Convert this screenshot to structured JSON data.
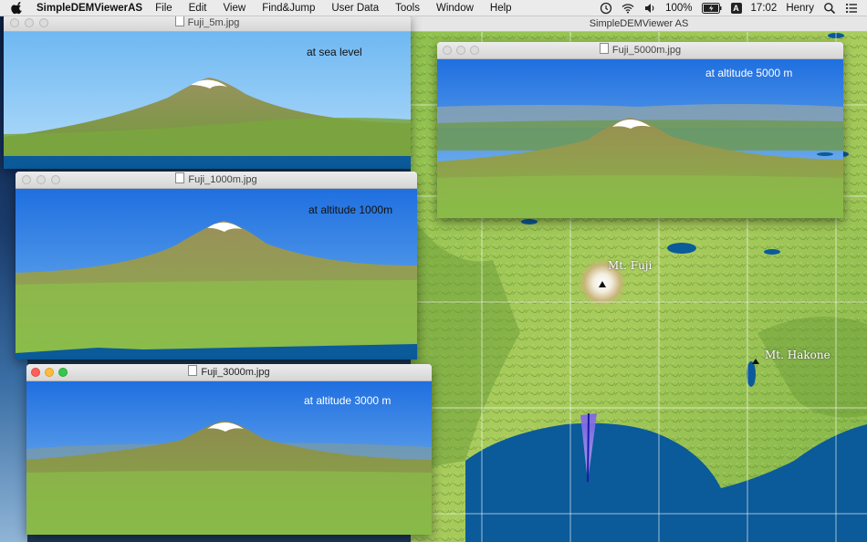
{
  "menubar": {
    "app_name": "SimpleDEMViewerAS",
    "items": [
      "File",
      "Edit",
      "View",
      "Find&Jump",
      "User Data",
      "Tools",
      "Window",
      "Help"
    ],
    "battery": "100%",
    "input_source": "A",
    "clock": "17:02",
    "user": "Henry"
  },
  "main_window": {
    "title": "SimpleDEMViewer AS",
    "labels": {
      "fuji": "Mt. Fuji",
      "hakone": "Mt. Hakone"
    }
  },
  "windows": [
    {
      "title": "Fuji_5m.jpg",
      "caption": "at sea level"
    },
    {
      "title": "Fuji_1000m.jpg",
      "caption": "at altitude 1000m"
    },
    {
      "title": "Fuji_3000m.jpg",
      "caption": "at altitude 3000 m"
    },
    {
      "title": "Fuji_5000m.jpg",
      "caption": "at altitude 5000 m"
    }
  ],
  "colors": {
    "sea": "#0b5a9a",
    "land": "#7cb342",
    "sky_top": "#1f6fe0",
    "sky_bottom": "#8cc8f2"
  }
}
